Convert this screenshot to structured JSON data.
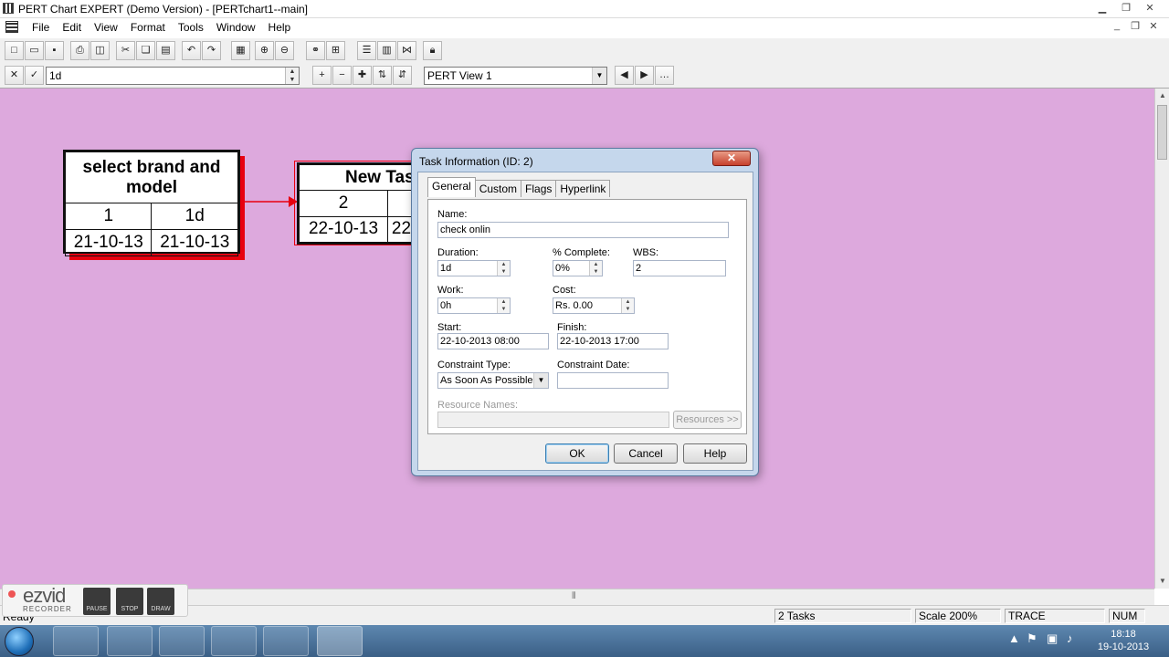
{
  "window": {
    "title": "PERT Chart EXPERT (Demo Version) - [PERTchart1--main]"
  },
  "menu": [
    "File",
    "Edit",
    "View",
    "Format",
    "Tools",
    "Window",
    "Help"
  ],
  "entry_bar": {
    "value": "1d"
  },
  "view_select": {
    "value": "PERT View 1"
  },
  "nodes": [
    {
      "title": "select brand and model",
      "id": "1",
      "duration": "1d",
      "start": "21-10-13",
      "finish": "21-10-13"
    },
    {
      "title": "New Tas",
      "id": "2",
      "start": "22-10-13",
      "finish": "22"
    }
  ],
  "dialog": {
    "title": "Task Information (ID: 2)",
    "close": "✕",
    "tabs": [
      "General",
      "Custom",
      "Flags",
      "Hyperlink"
    ],
    "labels": {
      "name": "Name:",
      "duration": "Duration:",
      "complete": "% Complete:",
      "wbs": "WBS:",
      "work": "Work:",
      "cost": "Cost:",
      "start": "Start:",
      "finish": "Finish:",
      "constraint_type": "Constraint Type:",
      "constraint_date": "Constraint Date:",
      "resource_names": "Resource Names:"
    },
    "values": {
      "name": "check onlin",
      "duration": "1d",
      "complete": "0%",
      "wbs": "2",
      "work": "0h",
      "cost": "Rs. 0.00",
      "start": "22-10-2013 08:00",
      "finish": "22-10-2013 17:00",
      "constraint_type": "As Soon As Possible",
      "constraint_date": "",
      "resource_names": ""
    },
    "buttons": {
      "resources": "Resources >>",
      "ok": "OK",
      "cancel": "Cancel",
      "help": "Help"
    }
  },
  "status": {
    "ready": "Ready",
    "tasks": "2 Tasks",
    "scale": "Scale 200%",
    "trace": "TRACE",
    "num": "NUM"
  },
  "ezvid": {
    "logo": "ezvid",
    "sub": "RECORDER",
    "pause": "PAUSE",
    "stop": "STOP",
    "draw": "DRAW"
  },
  "clock": {
    "time": "18:18",
    "date": "19-10-2013"
  },
  "colors": {
    "canvas": "#dda9dd",
    "node_shadow": "#e8000f",
    "connector": "#e8000f"
  }
}
